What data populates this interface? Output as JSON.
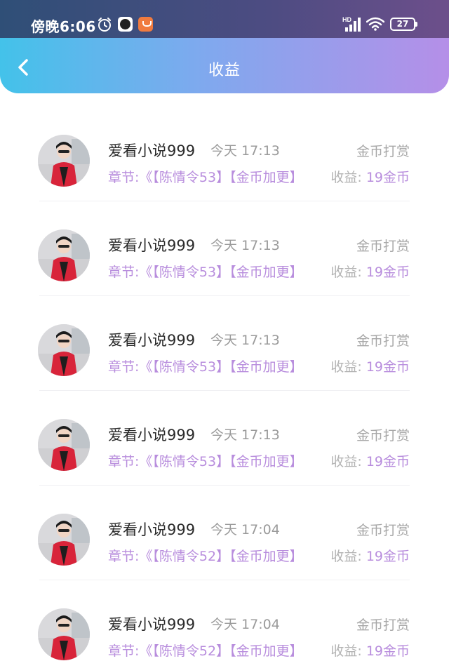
{
  "status_bar": {
    "time": "傍晚6:06",
    "battery": "27",
    "network": "HD"
  },
  "header": {
    "title": "收益"
  },
  "income_label": "收益:",
  "items": [
    {
      "name": "爱看小说999",
      "time": "今天 17:13",
      "type": "金币打赏",
      "chapter": "章节:《【陈情令53】【金币加更】",
      "income": "19金币"
    },
    {
      "name": "爱看小说999",
      "time": "今天 17:13",
      "type": "金币打赏",
      "chapter": "章节:《【陈情令53】【金币加更】",
      "income": "19金币"
    },
    {
      "name": "爱看小说999",
      "time": "今天 17:13",
      "type": "金币打赏",
      "chapter": "章节:《【陈情令53】【金币加更】",
      "income": "19金币"
    },
    {
      "name": "爱看小说999",
      "time": "今天 17:13",
      "type": "金币打赏",
      "chapter": "章节:《【陈情令53】【金币加更】",
      "income": "19金币"
    },
    {
      "name": "爱看小说999",
      "time": "今天 17:04",
      "type": "金币打赏",
      "chapter": "章节:《【陈情令52】【金币加更】",
      "income": "19金币"
    },
    {
      "name": "爱看小说999",
      "time": "今天 17:04",
      "type": "金币打赏",
      "chapter": "章节:《【陈情令52】【金币加更】",
      "income": "19金币"
    }
  ]
}
